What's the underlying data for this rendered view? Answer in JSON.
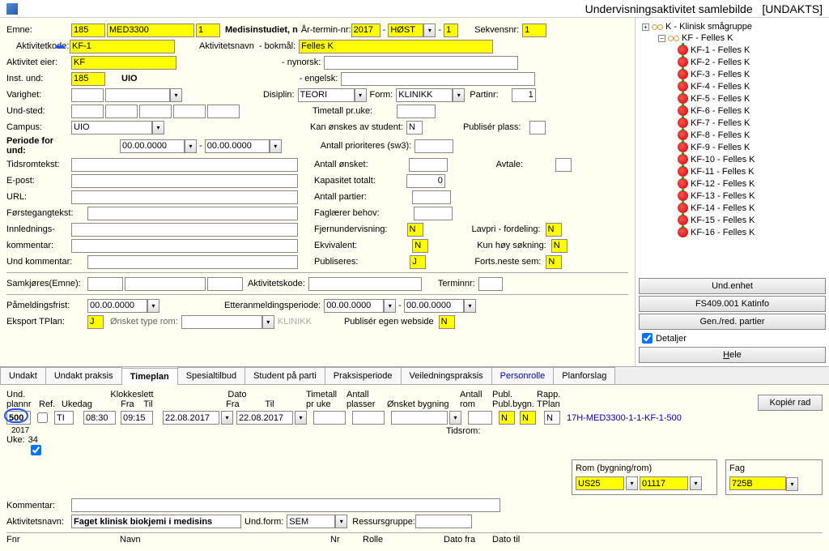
{
  "window": {
    "title": "Undervisningsaktivitet samlebilde",
    "id": "[UNDAKTS]"
  },
  "form": {
    "emne_lbl": "Emne:",
    "emne1": "185",
    "emne2": "MED3300",
    "emne3": "1",
    "study_lbl": "Medisinstudiet, n",
    "arterm_lbl": "År-termin-nr:",
    "year": "2017",
    "term": "HØST",
    "termnr": "1",
    "sekvens_lbl": "Sekvensnr:",
    "sekvens": "1",
    "aktkode_lbl": "Aktivitetkode:",
    "aktkode": "KF-1",
    "aktnavn_lbl": "Aktivitetsnavn",
    "bokmal_lbl": "- bokmål:",
    "bokmal": "Felles K",
    "akteier_lbl": "Aktivitet eier:",
    "akteier": "KF",
    "nynorsk_lbl": "- nynorsk:",
    "nynorsk": "",
    "instund_lbl": "Inst. und:",
    "instund1": "185",
    "instund2": "UIO",
    "engelsk_lbl": "- engelsk:",
    "engelsk": "",
    "varighet_lbl": "Varighet:",
    "disiplin_lbl": "Disiplin:",
    "disiplin": "TEORI",
    "form_lbl": "Form:",
    "form_val": "KLINIKK",
    "partinr_lbl": "Partinr:",
    "partinr": "1",
    "undsted_lbl": "Und-sted:",
    "timetall_lbl": "Timetall pr.uke:",
    "campus_lbl": "Campus:",
    "campus": "UIO",
    "kanonsk_lbl": "Kan ønskes av student:",
    "kanonsk": "N",
    "publplass_lbl": "Publisér plass:",
    "periode_lbl": "Periode for und:",
    "periode1": "00.00.0000",
    "periode2": "00.00.0000",
    "antpri_lbl": "Antall prioriteres (sw3):",
    "tidsrom_lbl": "Tidsromtekst:",
    "antonsket_lbl": "Antall ønsket:",
    "avtale_lbl": "Avtale:",
    "epost_lbl": "E-post:",
    "kaptot_lbl": "Kapasitet totalt:",
    "kaptot": "0",
    "url_lbl": "URL:",
    "antpart_lbl": "Antall partier:",
    "forstegang_lbl": "Førstegangtekst:",
    "faglar_lbl": "Faglærer behov:",
    "innled_lbl": "Innlednings-",
    "fjern_lbl": "Fjernundervisning:",
    "fjern": "N",
    "lavpri_lbl": "Lavpri - fordeling:",
    "lavpri": "N",
    "komm_lbl": "kommentar:",
    "ekviv_lbl": "Ekvivalent:",
    "ekviv": "N",
    "kunhoy_lbl": "Kun høy søkning:",
    "kunhoy": "N",
    "undkomm_lbl": "Und kommentar:",
    "publ_lbl": "Publiseres:",
    "publ": "J",
    "forts_lbl": "Forts.neste sem:",
    "forts": "N",
    "samkj_lbl": "Samkjøres(Emne):",
    "aktkode2_lbl": "Aktivitetskode:",
    "terminnr_lbl": "Terminnr:",
    "pameld_lbl": "Påmeldingsfrist:",
    "pameld": "00.00.0000",
    "etteranm_lbl": "Etteranmeldingsperiode:",
    "etter1": "00.00.0000",
    "etter2": "00.00.0000",
    "eksport_lbl": "Eksport TPlan:",
    "eksport": "J",
    "onskrom_lbl": "Ønsket type rom:",
    "onskrom_val": "KLINIKK",
    "publweb_lbl": "Publisér egen webside",
    "publweb": "N"
  },
  "tree": {
    "root": "K - Klinisk smågruppe",
    "sub": "KF - Felles K",
    "items": [
      "KF-1 - Felles K",
      "KF-2 - Felles K",
      "KF-3 - Felles K",
      "KF-4 - Felles K",
      "KF-5 - Felles K",
      "KF-6 - Felles K",
      "KF-7 - Felles K",
      "KF-8 - Felles K",
      "KF-9 - Felles K",
      "KF-10 - Felles K",
      "KF-11 - Felles K",
      "KF-12 - Felles K",
      "KF-13 - Felles K",
      "KF-14 - Felles K",
      "KF-15 - Felles K",
      "KF-16 - Felles K"
    ]
  },
  "sidebtn": {
    "undenhet": "Und.enhet",
    "katinfo": "FS409.001 Katinfo",
    "genred": "Gen./red. partier",
    "detaljer": "Detaljer",
    "hele": "Hele"
  },
  "tabs": [
    "Undakt",
    "Undakt praksis",
    "Timeplan",
    "Spesialtilbud",
    "Student på parti",
    "Praksisperiode",
    "Veiledningspraksis",
    "Personrolle",
    "Planforslag"
  ],
  "lower": {
    "headers": {
      "und": "Und.",
      "plannr": "plannr",
      "ref": "Ref.",
      "ukedag": "Ukedag",
      "klokke": "Klokkeslett",
      "fra": "Fra",
      "til": "Til",
      "dato": "Dato",
      "timetall": "Timetall",
      "pruke": "pr uke",
      "antall": "Antall",
      "plasser": "plasser",
      "onsket": "Ønsket bygning",
      "antrom": "Antall",
      "rom": "rom",
      "publ": "Publ.",
      "publbygn": "Publ.bygn.",
      "rapp": "Rapp.",
      "tplan": "TPlan"
    },
    "kopier": "Kopiér rad",
    "row": {
      "plannr": "500",
      "ukedag": "TI",
      "fra_t": "08:30",
      "til_t": "09:15",
      "fra_d": "22.08.2017",
      "til_d": "22.08.2017",
      "p1": "N",
      "p2": "N",
      "p3": "N",
      "link": "17H-MED3300-1-1-KF-1-500"
    },
    "year": "2017",
    "uke_lbl": "Uke:",
    "uke": "34",
    "tidsrom_lbl": "Tidsrom:",
    "rom_hdr": "Rom (bygning/rom)",
    "rom1": "US25",
    "rom2": "01117",
    "fag_hdr": "Fag",
    "fag": "725B",
    "komm_lbl": "Kommentar:",
    "aktnavn_lbl": "Aktivitetsnavn:",
    "aktnavn": "Faget klinisk biokjemi i medisins",
    "undform_lbl": "Und.form:",
    "undform": "SEM",
    "ressurs_lbl": "Ressursgruppe:",
    "fnr": "Fnr",
    "navn": "Navn",
    "nr": "Nr",
    "rolle": "Rolle",
    "datofra": "Dato fra",
    "datotil": "Dato til"
  }
}
